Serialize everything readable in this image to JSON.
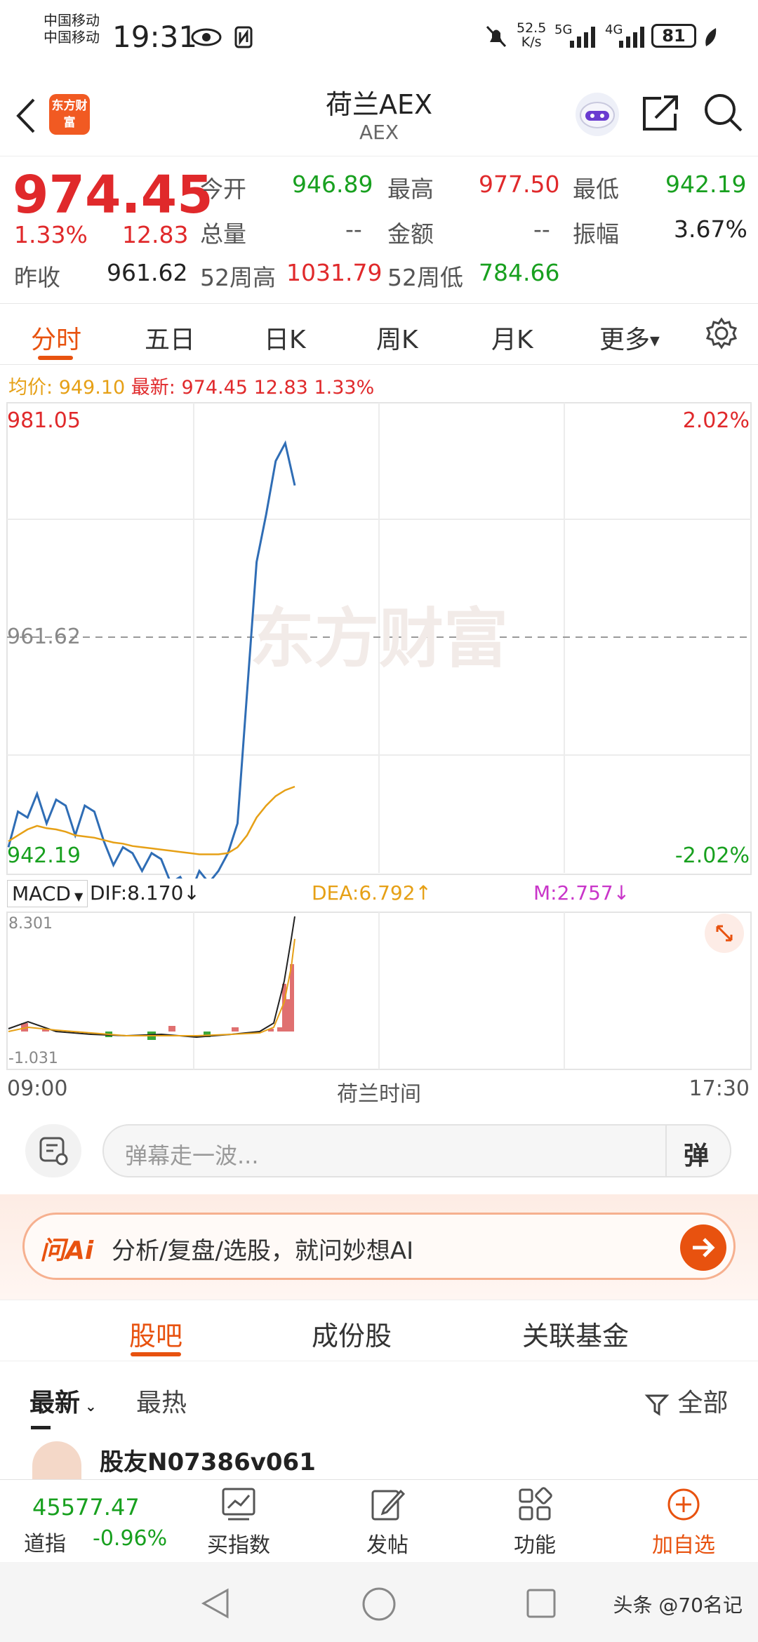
{
  "status_bar": {
    "carrier1": "中国移动",
    "carrier2": "中国移动",
    "time": "19:31",
    "net_speed_value": "52.5",
    "net_speed_unit": "K/s",
    "net_5g": "5G",
    "net_4g": "4G",
    "battery": "81"
  },
  "header": {
    "logo_text": "东方财富",
    "title": "荷兰AEX",
    "subtitle": "AEX"
  },
  "quote": {
    "price": "974.45",
    "change_pct": "1.33%",
    "change": "12.83",
    "open_label": "今开",
    "open": "946.89",
    "high_label": "最高",
    "high": "977.50",
    "low_label": "最低",
    "low": "942.19",
    "volume_label": "总量",
    "volume": "--",
    "amount_label": "金额",
    "amount": "--",
    "amplitude_label": "振幅",
    "amplitude": "3.67%",
    "prev_close_label": "昨收",
    "prev_close": "961.62",
    "wk52_high_label": "52周高",
    "wk52_high": "1031.79",
    "wk52_low_label": "52周低",
    "wk52_low": "784.66"
  },
  "tabs": [
    "分时",
    "五日",
    "日K",
    "周K",
    "月K",
    "更多"
  ],
  "avg_line": {
    "avg_label": "均价:",
    "avg": "949.10",
    "latest_label": "最新:",
    "latest": "974.45",
    "chg": "12.83",
    "pct": "1.33%"
  },
  "chart": {
    "y_top": "981.05",
    "y_mid": "961.62",
    "y_bottom": "942.19",
    "pct_top": "2.02%",
    "pct_bottom": "-2.02%",
    "watermark": "东方财富",
    "x_start": "09:00",
    "x_center": "荷兰时间",
    "x_end": "17:30",
    "macd_select": "MACD",
    "dif": "DIF:8.170↓",
    "dea": "DEA:6.792↑",
    "m": "M:2.757↓",
    "macd_top": "8.301",
    "macd_bottom": "-1.031"
  },
  "chart_data": {
    "type": "line",
    "title": "",
    "series": [
      {
        "values": [
          944.0,
          947.0,
          946.5,
          948.5,
          946.0,
          948.0,
          947.5,
          945.0,
          947.5,
          947.0,
          944.5,
          942.5,
          944.0,
          943.5,
          942.0,
          943.5,
          943.0,
          941.0,
          941.5,
          940.0,
          942.0,
          941.0,
          942.0,
          943.5,
          946.0,
          957.0,
          968.0,
          972.0,
          976.5,
          978.0,
          974.45
        ]
      },
      {
        "values": [
          944.5,
          945.0,
          945.5,
          945.8,
          945.6,
          945.5,
          945.3,
          945.0,
          944.9,
          944.8,
          944.6,
          944.4,
          944.3,
          944.1,
          944.0,
          943.9,
          943.8,
          943.7,
          943.6,
          943.5,
          943.4,
          943.4,
          943.4,
          943.5,
          944.0,
          945.0,
          946.5,
          947.5,
          948.3,
          948.8,
          949.1
        ]
      }
    ],
    "x_range": [
      "09:00",
      "17:30"
    ],
    "ylim": [
      942.19,
      981.05
    ],
    "prev_close": 961.62
  },
  "comment": {
    "placeholder": "弹幕走一波...",
    "toggle": "弹"
  },
  "ai": {
    "logo": "问Ai",
    "text": "分析/复盘/选股，就问妙想AI"
  },
  "sub_tabs": [
    "股吧",
    "成份股",
    "关联基金"
  ],
  "filters": {
    "latest": "最新",
    "hot": "最热",
    "all": "全部"
  },
  "post": {
    "user": "股友N07386v061"
  },
  "bottom_nav": {
    "index_value": "45577.47",
    "index_name": "道指",
    "index_change": "-0.96%",
    "buy_index": "买指数",
    "post": "发帖",
    "functions": "功能",
    "add_watch": "加自选"
  },
  "watermark_corner": "头条 @70名记"
}
